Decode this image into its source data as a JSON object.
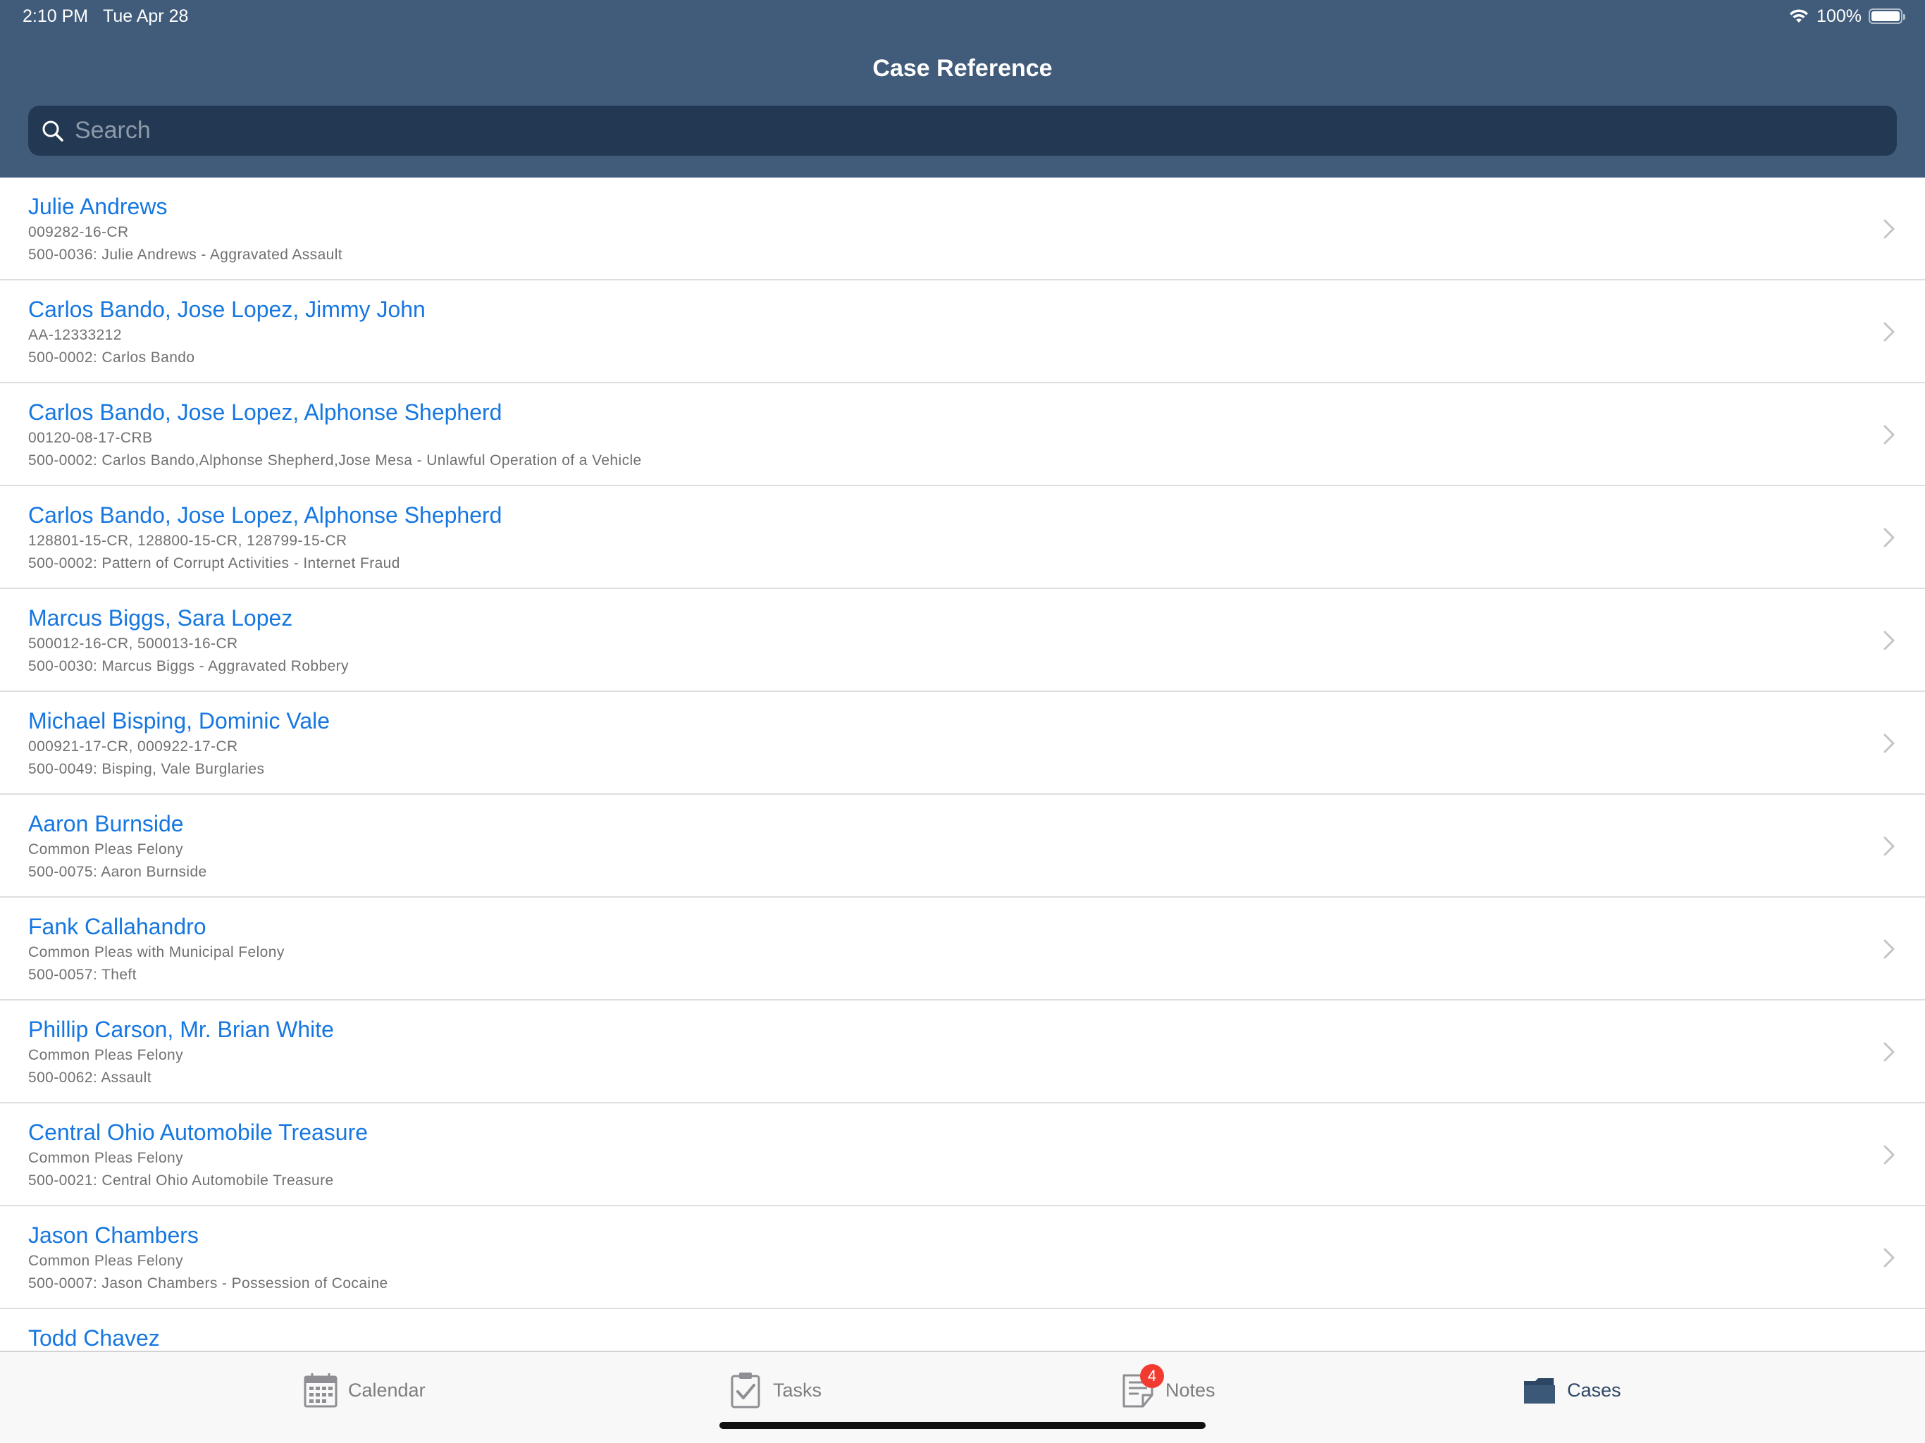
{
  "status_bar": {
    "time": "2:10 PM",
    "date": "Tue Apr 28",
    "battery": "100%"
  },
  "header": {
    "title": "Case Reference",
    "search_placeholder": "Search",
    "search_value": ""
  },
  "cases": [
    {
      "name": "Julie Andrews",
      "number": "009282-16-CR",
      "description": "500-0036: Julie Andrews - Aggravated Assault"
    },
    {
      "name": "Carlos Bando, Jose Lopez, Jimmy John",
      "number": "AA-12333212",
      "description": "500-0002: Carlos Bando"
    },
    {
      "name": "Carlos Bando, Jose Lopez, Alphonse Shepherd",
      "number": "00120-08-17-CRB",
      "description": "500-0002: Carlos Bando,Alphonse Shepherd,Jose Mesa - Unlawful Operation of a Vehicle"
    },
    {
      "name": "Carlos Bando, Jose Lopez, Alphonse Shepherd",
      "number": "128801-15-CR, 128800-15-CR, 128799-15-CR",
      "description": "500-0002: Pattern of Corrupt Activities - Internet Fraud"
    },
    {
      "name": "Marcus Biggs, Sara Lopez",
      "number": "500012-16-CR, 500013-16-CR",
      "description": "500-0030: Marcus Biggs - Aggravated Robbery"
    },
    {
      "name": "Michael Bisping, Dominic Vale",
      "number": "000921-17-CR, 000922-17-CR",
      "description": "500-0049: Bisping, Vale Burglaries"
    },
    {
      "name": "Aaron Burnside",
      "number": "Common Pleas Felony",
      "description": "500-0075: Aaron Burnside"
    },
    {
      "name": "Fank Callahandro",
      "number": "Common Pleas with Municipal Felony",
      "description": "500-0057: Theft"
    },
    {
      "name": "Phillip Carson, Mr. Brian White",
      "number": "Common Pleas Felony",
      "description": "500-0062: Assault"
    },
    {
      "name": "Central Ohio Automobile Treasure",
      "number": "Common Pleas Felony",
      "description": "500-0021: Central Ohio Automobile Treasure"
    },
    {
      "name": "Jason Chambers",
      "number": "Common Pleas Felony",
      "description": "500-0007: Jason Chambers - Possession of Cocaine"
    },
    {
      "name": "Todd Chavez",
      "number": "",
      "description": ""
    }
  ],
  "tab_bar": {
    "tabs": [
      {
        "label": "Calendar",
        "icon": "calendar-icon",
        "active": false
      },
      {
        "label": "Tasks",
        "icon": "tasks-icon",
        "active": false
      },
      {
        "label": "Notes",
        "icon": "notes-icon",
        "active": false,
        "badge": "4"
      },
      {
        "label": "Cases",
        "icon": "folder-icon",
        "active": true
      }
    ]
  },
  "colors": {
    "header_bg": "#415b7a",
    "search_bg": "#233953",
    "link_blue": "#1677e0",
    "active_tab": "#2c4664",
    "badge_red": "#f23b30"
  }
}
